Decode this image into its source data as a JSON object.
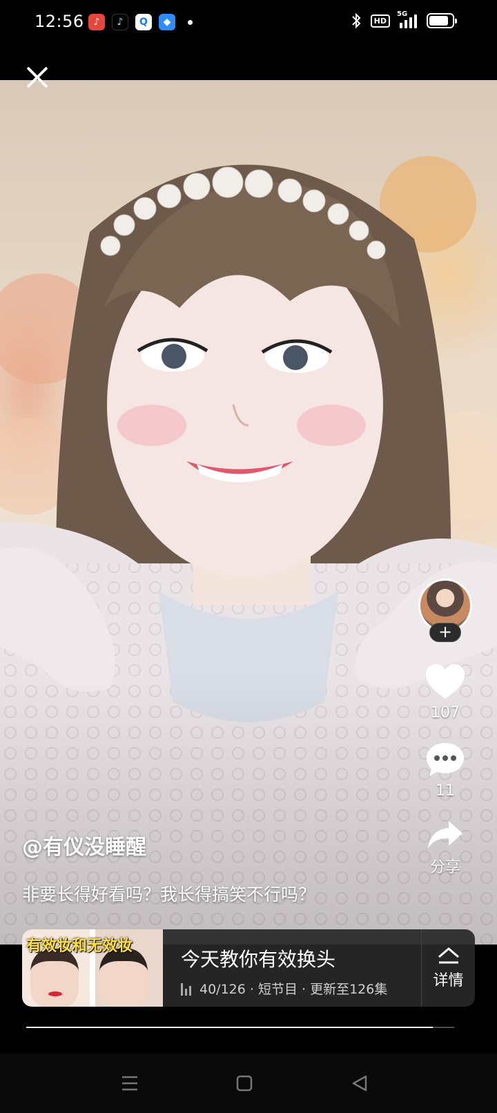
{
  "status_bar": {
    "time": "12:56",
    "app_icons": [
      {
        "name": "music-app-icon",
        "glyph": "♪",
        "color": "#e8453c"
      },
      {
        "name": "tiktok-app-icon",
        "glyph": "♪",
        "color": "#000000"
      },
      {
        "name": "search-app-icon",
        "glyph": "Q",
        "color": "#ffffff"
      },
      {
        "name": "blue-app-icon",
        "glyph": "◆",
        "color": "#2f8cff"
      }
    ],
    "hd_label": "HD",
    "network_label": "5G",
    "battery_level": 0.85
  },
  "video": {
    "author": "@有仪没睡醒",
    "caption": "非要长得好看吗？我长得搞笑不行吗？"
  },
  "rail": {
    "follow_label": "+",
    "likes": "107",
    "comments": "11",
    "share_label": "分享"
  },
  "series": {
    "thumb_title": "有效妆和无效妆",
    "title": "今天教你有效换头",
    "meta": "40/126 · 短节目 · 更新至126集",
    "detail_label": "详情"
  },
  "playback": {
    "progress": 0.95
  },
  "colors": {
    "accent_yellow": "#ffe033",
    "card_bg": "#282828"
  }
}
